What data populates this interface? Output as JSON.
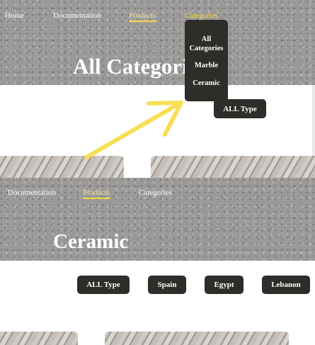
{
  "top_nav": {
    "home": "Home",
    "documentation": "Documentation",
    "products": "Products",
    "categories": "Categories"
  },
  "hero_title": "All Categori",
  "categories_dropdown": {
    "items": [
      {
        "line1": "All",
        "line2": "Categories"
      },
      {
        "line1": "Marble",
        "line2": ""
      },
      {
        "line1": "Ceramic",
        "line2": ""
      }
    ]
  },
  "type_filter_1": "ALL Type",
  "second_nav": {
    "documentation": "Documentation",
    "products": "Products",
    "categories": "Categories"
  },
  "ceramic_title": "Ceramic",
  "filters": [
    "ALL Type",
    "Spain",
    "Egypt",
    "Lebanon"
  ],
  "colors": {
    "dark_button": "#2f2d29",
    "accent_yellow": "#f5d848",
    "arrow_yellow": "#f7df55"
  },
  "icons": {
    "pointer_arrow": "arrow-up-right-icon"
  }
}
